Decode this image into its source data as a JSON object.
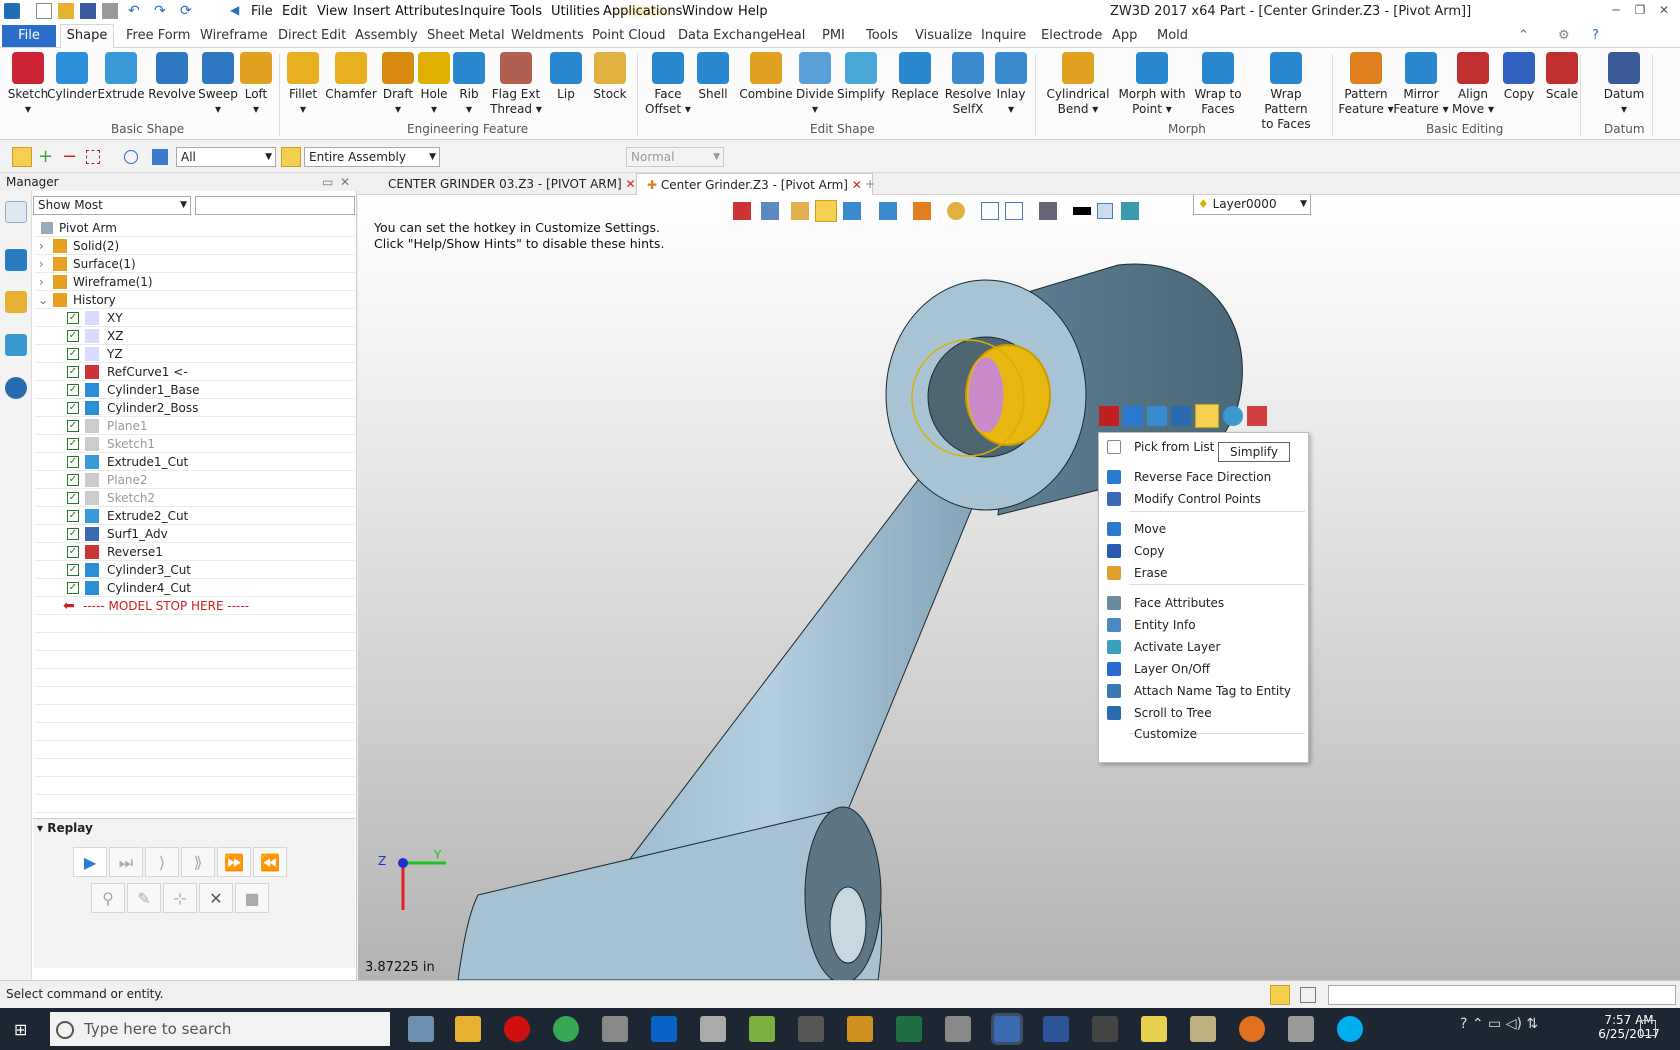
{
  "menubar": {
    "items": [
      "File",
      "Edit",
      "View",
      "Insert",
      "Attributes",
      "Inquire",
      "Tools",
      "Utilities",
      "Applications",
      "Window",
      "Help"
    ],
    "title": "ZW3D 2017  x64          Part - [Center Grinder.Z3 - [Pivot Arm]]"
  },
  "ribbon_tabs": [
    "File",
    "Shape",
    "Free Form",
    "Wireframe",
    "Direct Edit",
    "Assembly",
    "Sheet Metal",
    "Weldments",
    "Point Cloud",
    "Data Exchange",
    "Heal",
    "PMI",
    "Tools",
    "Visualize",
    "Inquire",
    "Electrode",
    "App",
    "Mold"
  ],
  "ribbon": {
    "buttons": [
      {
        "l1": "Sketch",
        "l2": "▾",
        "c": "#c23"
      },
      {
        "l1": "Cylinder",
        "l2": "",
        "c": "#2a8fd8"
      },
      {
        "l1": "Extrude",
        "l2": "",
        "c": "#3a9ad9"
      },
      {
        "l1": "Revolve",
        "l2": "",
        "c": "#2d78c0"
      },
      {
        "l1": "Sweep",
        "l2": "▾",
        "c": "#2d78c0"
      },
      {
        "l1": "Loft",
        "l2": "▾",
        "c": "#e0a020"
      },
      {
        "l1": "Fillet",
        "l2": "▾",
        "c": "#e8b020"
      },
      {
        "l1": "Chamfer",
        "l2": "",
        "c": "#e8b020"
      },
      {
        "l1": "Draft",
        "l2": "▾",
        "c": "#d88a10"
      },
      {
        "l1": "Hole",
        "l2": "▾",
        "c": "#e0b000"
      },
      {
        "l1": "Rib",
        "l2": "▾",
        "c": "#2a88d0"
      },
      {
        "l1": "Flag Ext",
        "l2": "Thread ▾",
        "c": "#b06050"
      },
      {
        "l1": "Lip",
        "l2": "",
        "c": "#2a88d0"
      },
      {
        "l1": "Stock",
        "l2": "",
        "c": "#e0b040"
      },
      {
        "l1": "Face",
        "l2": "Offset ▾",
        "c": "#2a88d0"
      },
      {
        "l1": "Shell",
        "l2": "",
        "c": "#2a88d0"
      },
      {
        "l1": "Combine",
        "l2": "",
        "c": "#e0a020"
      },
      {
        "l1": "Divide",
        "l2": "▾",
        "c": "#5aa0d8"
      },
      {
        "l1": "Simplify",
        "l2": "",
        "c": "#4aa8d8"
      },
      {
        "l1": "Replace",
        "l2": "",
        "c": "#2a88d0"
      },
      {
        "l1": "Resolve",
        "l2": "SelfX",
        "c": "#3a8ad0"
      },
      {
        "l1": "Inlay",
        "l2": "▾",
        "c": "#3a8ad0"
      },
      {
        "l1": "Cylindrical",
        "l2": "Bend   ▾",
        "c": "#e0a020"
      },
      {
        "l1": "Morph with",
        "l2": "Point  ▾",
        "c": "#2a88d0"
      },
      {
        "l1": "Wrap to",
        "l2": "Faces",
        "c": "#2a88d0"
      },
      {
        "l1": "Wrap Pattern",
        "l2": "to Faces",
        "c": "#2a88d0"
      },
      {
        "l1": "Pattern",
        "l2": "Feature ▾",
        "c": "#e08020"
      },
      {
        "l1": "Mirror",
        "l2": "Feature ▾",
        "c": "#2a88d0"
      },
      {
        "l1": "Align",
        "l2": "Move ▾",
        "c": "#c03030"
      },
      {
        "l1": "Copy",
        "l2": "",
        "c": "#3060c0"
      },
      {
        "l1": "Scale",
        "l2": "",
        "c": "#c03030"
      },
      {
        "l1": "Datum",
        "l2": "▾",
        "c": "#3a5a9a"
      }
    ],
    "groups": [
      "Basic Shape",
      "Engineering Feature",
      "Edit Shape",
      "Morph",
      "Basic Editing",
      "Datum"
    ]
  },
  "toolbar": {
    "filter": "All",
    "scope": "Entire Assembly",
    "mode": "Normal"
  },
  "manager": {
    "title": "Manager",
    "show": "Show Most",
    "root": "Pivot Arm",
    "folders": [
      "Solid(2)",
      "Surface(1)",
      "Wireframe(1)",
      "History"
    ],
    "history": [
      {
        "t": "XY",
        "dim": false
      },
      {
        "t": "XZ",
        "dim": false
      },
      {
        "t": "YZ",
        "dim": false
      },
      {
        "t": "RefCurve1 <-",
        "dim": false
      },
      {
        "t": "Cylinder1_Base",
        "dim": false
      },
      {
        "t": "Cylinder2_Boss",
        "dim": false
      },
      {
        "t": "Plane1",
        "dim": true
      },
      {
        "t": "Sketch1",
        "dim": true
      },
      {
        "t": "Extrude1_Cut",
        "dim": false
      },
      {
        "t": "Plane2",
        "dim": true
      },
      {
        "t": "Sketch2",
        "dim": true
      },
      {
        "t": "Extrude2_Cut",
        "dim": false
      },
      {
        "t": "Surf1_Adv",
        "dim": false
      },
      {
        "t": "Reverse1",
        "dim": false
      },
      {
        "t": "Cylinder3_Cut",
        "dim": false
      },
      {
        "t": "Cylinder4_Cut",
        "dim": false
      }
    ],
    "stop": "----- MODEL STOP HERE -----",
    "replay": "Replay"
  },
  "doc_tabs": [
    {
      "label": "CENTER GRINDER 03.Z3 - [PIVOT ARM]",
      "active": false
    },
    {
      "label": "Center Grinder.Z3 - [Pivot Arm]",
      "active": true
    }
  ],
  "viewport": {
    "hint": "You can set the hotkey in Customize Settings.\nClick \"Help/Show Hints\" to disable these hints.",
    "layer": "Layer0000",
    "scale": "3.87225 in"
  },
  "context_menu": {
    "items": [
      "Pick from List",
      "Reverse Face Direction",
      "Modify Control Points",
      "Move",
      "Copy",
      "Erase",
      "Face Attributes",
      "Entity Info",
      "Activate Layer",
      "Layer On/Off",
      "Attach Name Tag to Entity",
      "Scroll to Tree",
      "Customize"
    ],
    "tooltip": "Simplify"
  },
  "status": {
    "text": "Select command or entity."
  },
  "taskbar": {
    "search": "Type here to search",
    "time": "7:57 AM",
    "date": "6/25/2017"
  }
}
